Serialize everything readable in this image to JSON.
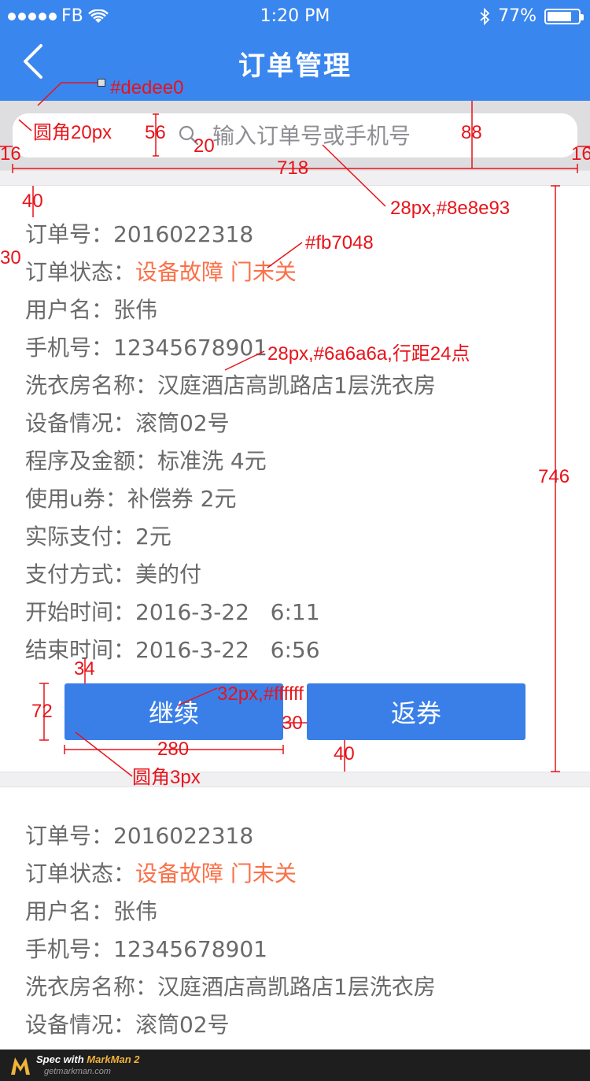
{
  "status_bar": {
    "carrier": "FB",
    "time": "1:20 PM",
    "battery": "77%"
  },
  "nav": {
    "title": "订单管理"
  },
  "search": {
    "placeholder": "输入订单号或手机号"
  },
  "buttons": {
    "continue": "继续",
    "refund_coupon": "返券"
  },
  "labels": {
    "order_no": "订单号：",
    "order_status": "订单状态：",
    "username": "用户名：",
    "phone": "手机号：",
    "laundry_name": "洗衣房名称：",
    "device": "设备情况：",
    "program_amount": "程序及金额：",
    "coupon": "使用u券：",
    "paid": "实际支付：",
    "pay_method": "支付方式：",
    "start_time": "开始时间：",
    "end_time": "结束时间："
  },
  "orders": [
    {
      "order_no": "2016022318",
      "order_status": "设备故障 门未关",
      "username": "张伟",
      "phone": "12345678901",
      "laundry_name": "汉庭酒店高凯路店1层洗衣房",
      "device": "滚筒02号",
      "program_amount": "标准洗 4元",
      "coupon": "补偿券 2元",
      "paid": "2元",
      "pay_method": "美的付",
      "start_time": "2016-3-22   6:11",
      "end_time": "2016-3-22   6:56"
    },
    {
      "order_no": "2016022318",
      "order_status": "设备故障 门未关",
      "username": "张伟",
      "phone": "12345678901",
      "laundry_name": "汉庭酒店高凯路店1层洗衣房",
      "device": "滚筒02号"
    }
  ],
  "annotations": {
    "bg_color": "#dedee0",
    "radius_20": "圆角20px",
    "h56": "56",
    "w20": "20",
    "h88": "88",
    "w16_left": "16",
    "w16_right": "16",
    "w718": "718",
    "placeholder_spec": "28px,#8e8e93",
    "h40_top": "40",
    "h30": "30",
    "status_color": "#fb7048",
    "text_spec": "28px,#6a6a6a,行距24点",
    "h746": "746",
    "h34": "34",
    "btn_text_spec": "32px,#ffffff",
    "h72": "72",
    "w30": "30",
    "w280": "280",
    "h40_bottom": "40",
    "radius_3": "圆角3px"
  },
  "watermark": {
    "prefix": "Spec with ",
    "brand": "MarkMan 2",
    "site": "getmarkman.com"
  }
}
